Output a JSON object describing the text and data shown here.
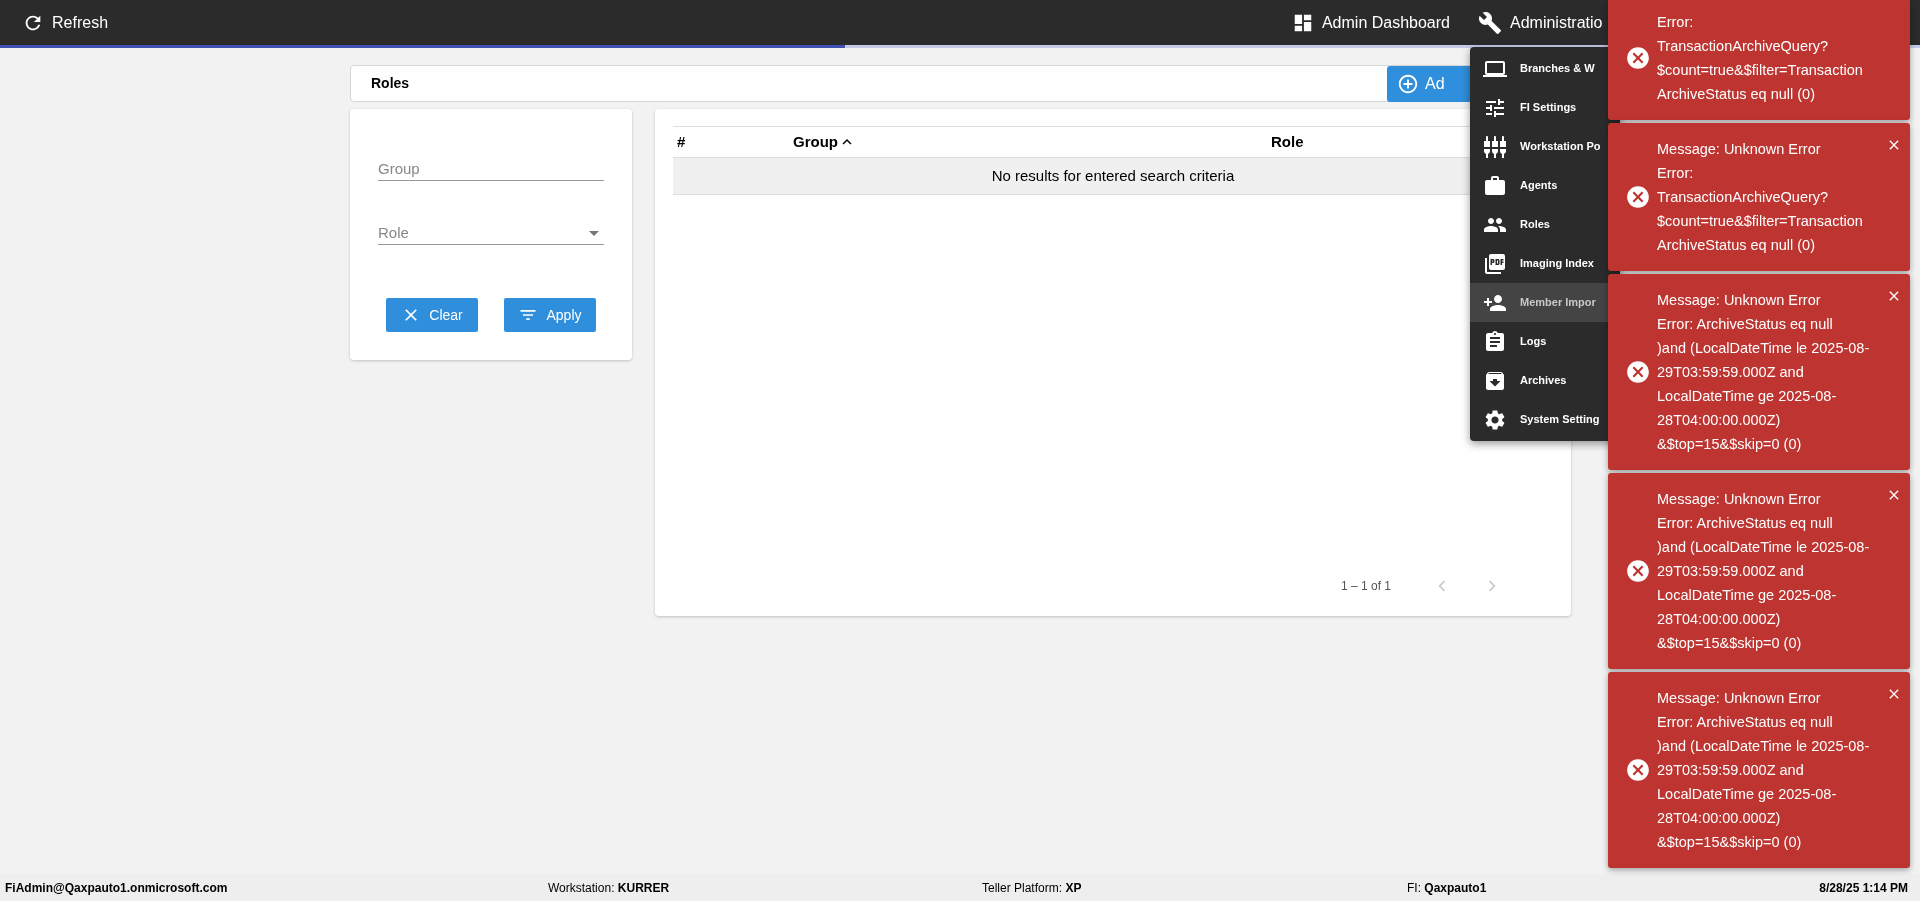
{
  "topbar": {
    "refresh": "Refresh",
    "admin_dashboard": "Admin Dashboard",
    "administration": "Administratio",
    "loading": {
      "level": 0.44
    }
  },
  "page": {
    "title": "Roles",
    "add_button": "Ad"
  },
  "filters": {
    "group": {
      "placeholder": "Group"
    },
    "role": {
      "placeholder": "Role"
    },
    "clear": "Clear",
    "apply": "Apply"
  },
  "table": {
    "columns": [
      {
        "label": "#",
        "sorted": false
      },
      {
        "label": "Group",
        "sorted": true
      },
      {
        "label": "Role",
        "sorted": false
      }
    ],
    "empty": "No results for entered search criteria",
    "pagination": "1 – 1 of 1"
  },
  "menu": [
    {
      "label": "Branches & W",
      "selected": false
    },
    {
      "label": "FI Settings",
      "selected": false
    },
    {
      "label": "Workstation Po",
      "selected": false
    },
    {
      "label": "Agents",
      "selected": false
    },
    {
      "label": "Roles",
      "selected": false
    },
    {
      "label": "Imaging Index",
      "selected": false
    },
    {
      "label": "Member Impor",
      "selected": true
    },
    {
      "label": "Logs",
      "selected": false
    },
    {
      "label": "Archives",
      "selected": false
    },
    {
      "label": "System Setting",
      "selected": false
    }
  ],
  "toasts": [
    {
      "text": "Error:\nTransactionArchiveQuery?\n$count=true&$filter=Transaction\nArchiveStatus eq null (0)",
      "closable": false
    },
    {
      "text": "Message: Unknown Error\nError:\nTransactionArchiveQuery?\n$count=true&$filter=Transaction\nArchiveStatus eq null (0)",
      "closable": true
    },
    {
      "text": "Message: Unknown Error\nError: ArchiveStatus eq null\n)and (LocalDateTime le 2025-08-\n29T03:59:59.000Z and\nLocalDateTime ge 2025-08-\n28T04:00:00.000Z)\n&$top=15&$skip=0 (0)",
      "closable": true
    },
    {
      "text": "Message: Unknown Error\nError: ArchiveStatus eq null\n)and (LocalDateTime le 2025-08-\n29T03:59:59.000Z and\nLocalDateTime ge 2025-08-\n28T04:00:00.000Z)\n&$top=15&$skip=0 (0)",
      "closable": true
    },
    {
      "text": "Message: Unknown Error\nError: ArchiveStatus eq null\n)and (LocalDateTime le 2025-08-\n29T03:59:59.000Z and\nLocalDateTime ge 2025-08-\n28T04:00:00.000Z)\n&$top=15&$skip=0 (0)",
      "closable": true
    }
  ],
  "footer": {
    "user": "FiAdmin@Qaxpauto1.onmicrosoft.com",
    "fields": [
      {
        "label": "Workstation:",
        "value": "KURRER"
      },
      {
        "label": "Teller Platform:",
        "value": "XP"
      },
      {
        "label": "FI:",
        "value": "Qaxpauto1"
      }
    ],
    "datetime": "8/28/25 1:14 PM"
  }
}
